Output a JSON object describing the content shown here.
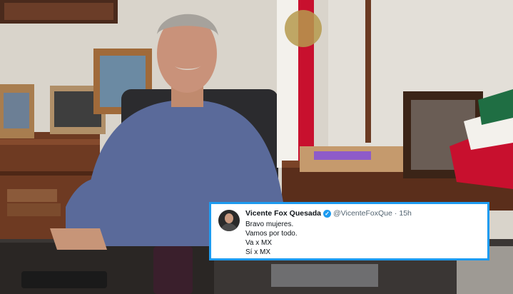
{
  "tweet": {
    "author_name": "Vicente Fox Quesada",
    "handle": "@VicenteFoxQue",
    "separator": "·",
    "time": "15h",
    "lines": [
      "Bravo mujeres.",
      "Vamos por todo.",
      "Va x MX",
      "Sí x MX"
    ]
  },
  "colors": {
    "tweet_border": "#1d9bf0",
    "flag_green": "#1f6e43",
    "flag_red": "#c8102e",
    "wall": "#d8d3ca"
  },
  "icons": {
    "verified": "verified-badge-icon",
    "avatar": "profile-avatar"
  }
}
